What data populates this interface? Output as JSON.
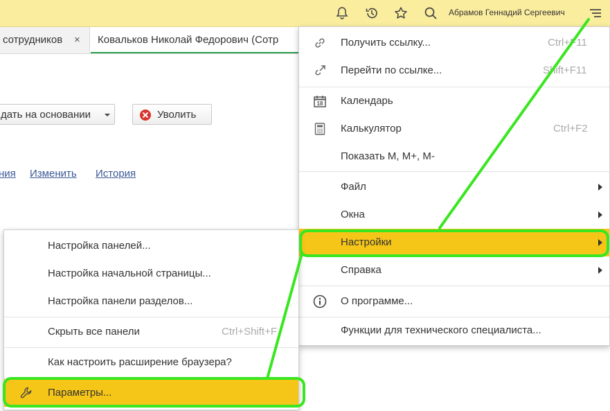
{
  "topbar": {
    "user_name": "Абрамов Геннадий Сергеевич",
    "icons": [
      "bell-icon",
      "history-icon",
      "star-icon",
      "search-icon",
      "menu-icon"
    ],
    "background_color": "#fbed9e"
  },
  "tabs": [
    {
      "label": "сотрудников",
      "close": "×"
    },
    {
      "label": "Ковальков Николай Федорович (Сотр"
    }
  ],
  "form": {
    "base_button": "дать на основании",
    "dismiss_button": "Уволить",
    "links": [
      "ния",
      "Изменить",
      "История"
    ]
  },
  "main_menu": {
    "items": [
      {
        "label": "Получить ссылку...",
        "shortcut": "Ctrl+F11",
        "icon": "link-icon"
      },
      {
        "label": "Перейти по ссылке...",
        "shortcut": "Shift+F11",
        "icon": "go-link-icon"
      },
      {
        "label": "Календарь",
        "shortcut": "",
        "icon": "calendar-icon",
        "icon_text": "18"
      },
      {
        "label": "Калькулятор",
        "shortcut": "Ctrl+F2",
        "icon": "calculator-icon"
      },
      {
        "label": "Показать M, M+, M-",
        "shortcut": ""
      },
      {
        "label": "Файл",
        "submenu": true
      },
      {
        "label": "Окна",
        "submenu": true
      },
      {
        "label": "Настройки",
        "submenu": true,
        "highlighted": true
      },
      {
        "label": "Справка",
        "submenu": true
      },
      {
        "label": "О программе...",
        "icon": "info-icon"
      },
      {
        "label": "Функции для технического специалиста..."
      }
    ]
  },
  "settings_submenu": {
    "items": [
      {
        "label": "Настройка панелей..."
      },
      {
        "label": "Настройка начальной страницы..."
      },
      {
        "label": "Настройка панели разделов..."
      },
      {
        "label": "Скрыть все панели",
        "shortcut": "Ctrl+Shift+F"
      },
      {
        "label": "Как настроить расширение браузера?"
      },
      {
        "label": "Параметры...",
        "icon": "wrench-icon",
        "highlighted": true
      }
    ]
  },
  "colors": {
    "highlight": "#f5c518",
    "annotation": "#39e620"
  }
}
